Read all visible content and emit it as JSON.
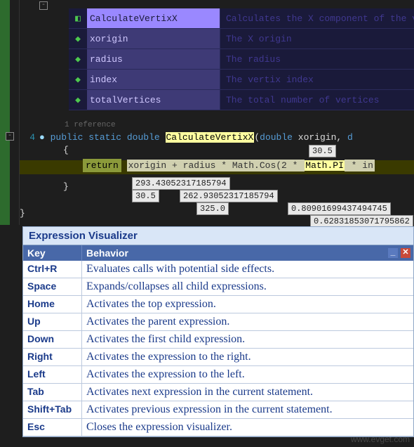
{
  "intellisense": {
    "items": [
      {
        "icon": "method-icon",
        "label": "CalculateVertixX",
        "desc": "Calculates the X component of the vert",
        "selected": true
      },
      {
        "icon": "field-icon",
        "label": "xorigin",
        "desc": "The X origin",
        "selected": false
      },
      {
        "icon": "field-icon",
        "label": "radius",
        "desc": "The radius",
        "selected": false
      },
      {
        "icon": "field-icon",
        "label": "index",
        "desc": "The vertix index",
        "selected": false
      },
      {
        "icon": "field-icon",
        "label": "totalVertices",
        "desc": "The total number of vertices",
        "selected": false
      }
    ]
  },
  "references": "1 reference",
  "linenum": "4",
  "code": {
    "sig_public": "public",
    "sig_static": "static",
    "sig_double": "double",
    "sig_method": "CalculateVertixX",
    "sig_paren_open": "(",
    "sig_param1_type": "double",
    "sig_param1_name": "xorigin",
    "sig_comma": ", ",
    "sig_tail": "d",
    "open_brace": "{",
    "return_kw": "return",
    "expr": "xorigin + radius * Math.Cos(2 * ",
    "mathpi": "Math.PI",
    "expr_tail": " * in",
    "close_brace": "}",
    "close_brace2": "}"
  },
  "values": {
    "topright": "30.5",
    "v1": "293.43052317185794",
    "v2": "30.5",
    "v3": "262.93052317185794",
    "v4": "325.0",
    "v5": "0.80901699437494745",
    "v6": "0.62831853071795862"
  },
  "visualizer": {
    "title": "Expression Visualizer",
    "headers": {
      "key": "Key",
      "behavior": "Behavior"
    },
    "rows": [
      {
        "key": "Ctrl+R",
        "behavior": "Evaluates calls with potential side effects."
      },
      {
        "key": "Space",
        "behavior": "Expands/collapses all child expressions."
      },
      {
        "key": "Home",
        "behavior": "Activates the top expression."
      },
      {
        "key": "Up",
        "behavior": "Activates the parent expression."
      },
      {
        "key": "Down",
        "behavior": "Activates the first child expression."
      },
      {
        "key": "Right",
        "behavior": "Activates the expression to the right."
      },
      {
        "key": "Left",
        "behavior": "Activates the expression to the left."
      },
      {
        "key": "Tab",
        "behavior": "Activates next expression in the current statement."
      },
      {
        "key": "Shift+Tab",
        "behavior": "Activates previous expression in the current statement."
      },
      {
        "key": "Esc",
        "behavior": "Closes the expression visualizer."
      }
    ]
  },
  "watermark": "www.evget.com"
}
